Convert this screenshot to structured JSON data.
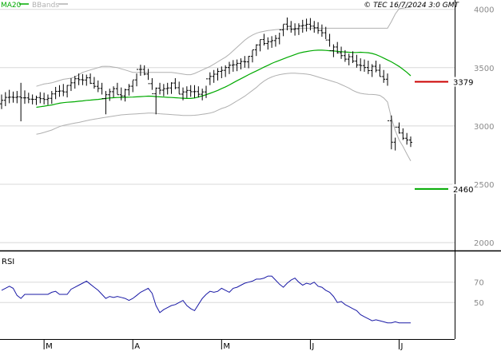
{
  "legend": {
    "ma_label": "MA20",
    "bbands_label": "BBands"
  },
  "credit": "© TEC 16/7/2024 3:0 GMT",
  "colors": {
    "price": "#000000",
    "ma": "#00aa00",
    "bbands": "#b0b0b0",
    "rsi": "#1a1aa6",
    "resistance": "#cc0000",
    "support": "#00aa00",
    "grid": "#d8d8d8"
  },
  "chart_data": [
    {
      "type": "line",
      "title": "",
      "ylim": [
        1960,
        4080
      ],
      "y_ticks": [
        {
          "value": 4000,
          "label": "4000"
        },
        {
          "value": 3500,
          "label": "3500"
        },
        {
          "value": 3000,
          "label": "3000"
        },
        {
          "value": 2500,
          "label": "2500"
        },
        {
          "value": 2000,
          "label": "2000"
        }
      ],
      "x_ticks": [
        "M",
        "A",
        "M",
        "J",
        "J"
      ],
      "x_tick_index": [
        11,
        34,
        57,
        80,
        103
      ],
      "series": [
        {
          "name": "MA20",
          "kind": "line",
          "values": [
            3160,
            3165,
            3170,
            3175,
            3180,
            3188,
            3195,
            3200,
            3203,
            3205,
            3208,
            3212,
            3215,
            3220,
            3222,
            3225,
            3228,
            3232,
            3236,
            3240,
            3242,
            3244,
            3245,
            3246,
            3247,
            3248,
            3250,
            3252,
            3254,
            3256,
            3255,
            3252,
            3250,
            3248,
            3246,
            3244,
            3242,
            3240,
            3238,
            3236,
            3236,
            3240,
            3248,
            3258,
            3268,
            3280,
            3292,
            3305,
            3320,
            3335,
            3352,
            3370,
            3388,
            3405,
            3422,
            3440,
            3456,
            3472,
            3488,
            3505,
            3520,
            3536,
            3550,
            3562,
            3575,
            3588,
            3600,
            3612,
            3624,
            3632,
            3638,
            3644,
            3648,
            3650,
            3650,
            3648,
            3645,
            3643,
            3640,
            3637,
            3634,
            3632,
            3630,
            3630,
            3632,
            3630,
            3628,
            3622,
            3612,
            3598,
            3582,
            3566,
            3550,
            3530,
            3510,
            3486,
            3460,
            3430
          ]
        },
        {
          "name": "BBands upper",
          "kind": "line",
          "values": [
            3340,
            3350,
            3360,
            3365,
            3370,
            3380,
            3390,
            3400,
            3405,
            3410,
            3420,
            3440,
            3460,
            3470,
            3480,
            3490,
            3500,
            3510,
            3512,
            3510,
            3505,
            3500,
            3490,
            3480,
            3470,
            3460,
            3460,
            3460,
            3460,
            3460,
            3460,
            3460,
            3460,
            3460,
            3460,
            3460,
            3455,
            3450,
            3445,
            3440,
            3440,
            3450,
            3465,
            3480,
            3495,
            3510,
            3530,
            3550,
            3570,
            3590,
            3615,
            3645,
            3675,
            3705,
            3735,
            3760,
            3780,
            3795,
            3805,
            3812,
            3818,
            3822,
            3826,
            3828,
            3830,
            3832,
            3834,
            3836,
            3838,
            3838,
            3838,
            3838,
            3838,
            3838,
            3838,
            3838,
            3838,
            3838,
            3838,
            3838,
            3838,
            3838,
            3838,
            3838,
            3838,
            3838,
            3838,
            3838,
            3838,
            3838,
            3838,
            3838,
            3895,
            3960,
            4005,
            4010,
            4015,
            4020
          ]
        },
        {
          "name": "BBands lower",
          "kind": "line",
          "values": [
            2930,
            2935,
            2945,
            2955,
            2965,
            2980,
            2995,
            3005,
            3012,
            3018,
            3025,
            3030,
            3038,
            3045,
            3052,
            3058,
            3064,
            3070,
            3075,
            3080,
            3085,
            3090,
            3095,
            3098,
            3100,
            3102,
            3104,
            3106,
            3108,
            3110,
            3110,
            3108,
            3105,
            3102,
            3100,
            3098,
            3095,
            3093,
            3090,
            3090,
            3090,
            3092,
            3095,
            3100,
            3105,
            3110,
            3120,
            3135,
            3150,
            3160,
            3175,
            3195,
            3215,
            3235,
            3255,
            3280,
            3305,
            3330,
            3360,
            3385,
            3405,
            3420,
            3432,
            3440,
            3446,
            3450,
            3452,
            3452,
            3450,
            3448,
            3445,
            3440,
            3430,
            3420,
            3410,
            3400,
            3390,
            3380,
            3370,
            3355,
            3340,
            3325,
            3305,
            3290,
            3280,
            3275,
            3272,
            3270,
            3268,
            3262,
            3240,
            3205,
            3070,
            2960,
            2880,
            2825,
            2760,
            2700
          ]
        },
        {
          "name": "Price",
          "kind": "ohlc",
          "open": [
            3190,
            3220,
            3245,
            3247,
            3245,
            3250,
            3241,
            3241,
            3230,
            3228,
            3244,
            3234,
            3227,
            3237,
            3275,
            3297,
            3300,
            3292,
            3348,
            3370,
            3405,
            3397,
            3394,
            3413,
            3366,
            3340,
            3322,
            3235,
            3268,
            3294,
            3320,
            3268,
            3258,
            3310,
            3341,
            3395,
            3485,
            3485,
            3445,
            3363,
            3276,
            3324,
            3307,
            3320,
            3326,
            3368,
            3328,
            3273,
            3292,
            3305,
            3294,
            3295,
            3272,
            3292,
            3404,
            3425,
            3444,
            3468,
            3477,
            3501,
            3521,
            3525,
            3537,
            3553,
            3550,
            3597,
            3653,
            3695,
            3741,
            3707,
            3723,
            3732,
            3751,
            3824,
            3873,
            3854,
            3828,
            3833,
            3857,
            3862,
            3872,
            3856,
            3842,
            3819,
            3799,
            3737,
            3646,
            3677,
            3628,
            3603,
            3573,
            3594,
            3556,
            3523,
            3518,
            3501,
            3475,
            3512,
            3478,
            3424,
            3401,
            3045,
            2861,
            2990,
            2940,
            2895,
            2880
          ],
          "high": [
            3270,
            3290,
            3310,
            3295,
            3300,
            3370,
            3305,
            3285,
            3270,
            3260,
            3290,
            3285,
            3270,
            3300,
            3335,
            3350,
            3360,
            3350,
            3410,
            3430,
            3450,
            3445,
            3440,
            3450,
            3420,
            3390,
            3370,
            3300,
            3320,
            3340,
            3370,
            3330,
            3320,
            3360,
            3390,
            3450,
            3525,
            3520,
            3490,
            3410,
            3330,
            3370,
            3360,
            3370,
            3375,
            3410,
            3380,
            3330,
            3340,
            3350,
            3350,
            3340,
            3320,
            3345,
            3460,
            3480,
            3495,
            3510,
            3520,
            3550,
            3565,
            3570,
            3580,
            3600,
            3600,
            3650,
            3700,
            3740,
            3790,
            3760,
            3770,
            3780,
            3800,
            3870,
            3930,
            3900,
            3880,
            3880,
            3910,
            3920,
            3925,
            3900,
            3890,
            3870,
            3850,
            3790,
            3700,
            3720,
            3680,
            3650,
            3620,
            3640,
            3610,
            3580,
            3570,
            3560,
            3530,
            3560,
            3530,
            3480,
            3450,
            3090,
            2900,
            3030,
            2980,
            2940,
            2910
          ],
          "low": [
            3145,
            3170,
            3195,
            3200,
            3195,
            3040,
            3190,
            3195,
            3185,
            3180,
            3195,
            3185,
            3180,
            3190,
            3230,
            3250,
            3255,
            3245,
            3300,
            3320,
            3350,
            3350,
            3345,
            3360,
            3320,
            3290,
            3270,
            3100,
            3215,
            3245,
            3270,
            3220,
            3210,
            3260,
            3290,
            3340,
            3430,
            3435,
            3395,
            3310,
            3100,
            3270,
            3255,
            3270,
            3275,
            3315,
            3275,
            3220,
            3240,
            3250,
            3240,
            3245,
            3220,
            3240,
            3350,
            3370,
            3390,
            3410,
            3420,
            3445,
            3465,
            3470,
            3485,
            3500,
            3495,
            3545,
            3600,
            3640,
            3690,
            3655,
            3670,
            3680,
            3700,
            3770,
            3820,
            3800,
            3775,
            3780,
            3800,
            3810,
            3820,
            3800,
            3790,
            3765,
            3745,
            3680,
            3590,
            3620,
            3575,
            3550,
            3520,
            3540,
            3500,
            3470,
            3465,
            3445,
            3420,
            3460,
            3425,
            3370,
            3345,
            2800,
            2790,
            2935,
            2880,
            2840,
            2820
          ],
          "close": [
            3220,
            3245,
            3247,
            3245,
            3250,
            3241,
            3241,
            3230,
            3228,
            3244,
            3234,
            3227,
            3237,
            3275,
            3297,
            3300,
            3292,
            3348,
            3370,
            3405,
            3397,
            3394,
            3413,
            3366,
            3340,
            3322,
            3235,
            3268,
            3294,
            3320,
            3268,
            3258,
            3310,
            3341,
            3395,
            3485,
            3485,
            3445,
            3363,
            3276,
            3324,
            3307,
            3320,
            3326,
            3368,
            3328,
            3273,
            3292,
            3305,
            3294,
            3295,
            3272,
            3292,
            3404,
            3425,
            3444,
            3468,
            3477,
            3501,
            3521,
            3525,
            3537,
            3553,
            3550,
            3597,
            3653,
            3695,
            3741,
            3707,
            3723,
            3732,
            3751,
            3824,
            3873,
            3854,
            3828,
            3833,
            3857,
            3862,
            3872,
            3856,
            3842,
            3819,
            3799,
            3737,
            3646,
            3677,
            3628,
            3603,
            3573,
            3594,
            3556,
            3523,
            3518,
            3501,
            3475,
            3512,
            3478,
            3424,
            3401,
            3045,
            2861,
            2990,
            2940,
            2895,
            2880,
            2860
          ]
        }
      ],
      "levels": [
        {
          "name": "resistance",
          "value": 3379,
          "label": "3379"
        },
        {
          "name": "support",
          "value": 2460,
          "label": "2460"
        }
      ]
    },
    {
      "type": "line",
      "title": "RSI",
      "ylim": [
        18,
        98
      ],
      "y_ticks": [
        {
          "value": 70,
          "label": "70"
        },
        {
          "value": 50,
          "label": "50"
        }
      ],
      "series": [
        {
          "name": "RSI",
          "values": [
            62,
            64,
            66,
            64,
            57,
            54,
            58,
            58,
            58,
            58,
            58,
            58,
            58,
            60,
            61,
            58,
            58,
            58,
            63,
            65,
            67,
            69,
            71,
            68,
            65,
            62,
            58,
            54,
            56,
            55,
            56,
            55,
            54,
            52,
            54,
            57,
            60,
            62,
            64,
            59,
            47,
            40,
            43,
            45,
            47,
            48,
            50,
            52,
            47,
            44,
            42,
            48,
            54,
            58,
            61,
            60,
            61,
            64,
            62,
            60,
            64,
            65,
            67,
            69,
            70,
            71,
            73,
            73,
            74,
            76,
            76,
            72,
            68,
            65,
            69,
            72,
            74,
            70,
            67,
            69,
            68,
            70,
            66,
            65,
            62,
            60,
            56,
            50,
            51,
            48,
            46,
            44,
            42,
            38,
            36,
            34,
            32,
            33,
            32,
            31,
            30,
            30,
            31,
            30,
            30,
            30,
            30
          ]
        }
      ]
    }
  ]
}
